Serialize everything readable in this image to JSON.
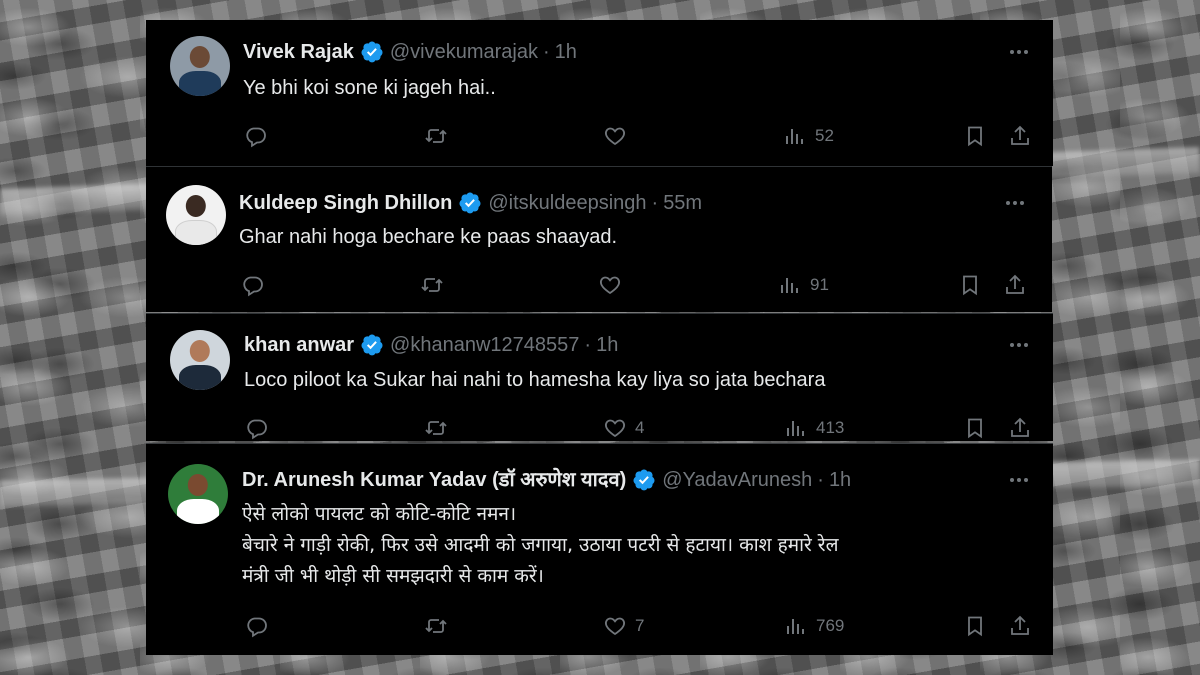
{
  "tweets": [
    {
      "name": "Vivek Rajak",
      "handle": "@vivekumarajak",
      "dot": "·",
      "time": "1h",
      "text": "Ye bhi koi sone ki jageh hai..",
      "views": "52",
      "likes": "",
      "avatar_colors": {
        "bg": "#8e9aa6",
        "face": "#6b4a36",
        "body": "#1f3b5a"
      }
    },
    {
      "name": "Kuldeep Singh Dhillon",
      "handle": "@itskuldeepsingh",
      "dot": "·",
      "time": "55m",
      "text": "Ghar nahi hoga bechare ke paas shaayad.",
      "views": "91",
      "likes": "",
      "avatar_colors": {
        "bg": "#f2f2f2",
        "face": "#3a2a22",
        "body": "#e9e9e9"
      }
    },
    {
      "name": "khan anwar",
      "handle": "@khananw12748557",
      "dot": "·",
      "time": "1h",
      "text": "Loco piloot ka Sukar hai nahi to hamesha kay liya so jata bechara",
      "views": "413",
      "likes": "4",
      "avatar_colors": {
        "bg": "#cfd6dc",
        "face": "#b07a5a",
        "body": "#1d2a3a"
      }
    },
    {
      "name": "Dr. Arunesh Kumar Yadav (डॉ अरुणेश यादव)",
      "handle": "@YadavArunesh",
      "dot": "·",
      "time": "1h",
      "text_lines": [
        "ऐसे लोको पायलट को कोटि-कोटि नमन।",
        " बेचारे ने गाड़ी रोकी, फिर उसे आदमी को जगाया, उठाया पटरी से हटाया। काश हमारे रेल",
        "मंत्री जी भी थोड़ी सी समझदारी से काम करें।"
      ],
      "views": "769",
      "likes": "7",
      "avatar_colors": {
        "bg": "#2f7d3a",
        "face": "#7a4a30",
        "body": "#ffffff"
      }
    }
  ],
  "colors": {
    "card_bg": "#000000",
    "text": "#e7e9ea",
    "muted": "#71767b",
    "verified": "#1d9bf0"
  },
  "icons": [
    "reply-icon",
    "retweet-icon",
    "like-icon",
    "views-icon",
    "bookmark-icon",
    "share-icon",
    "more-icon",
    "verified-badge-icon"
  ]
}
